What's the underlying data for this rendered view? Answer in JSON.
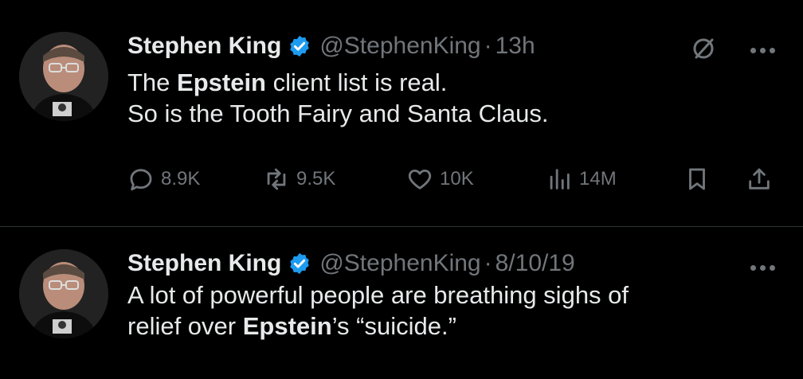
{
  "tweets": [
    {
      "author_name": "Stephen King",
      "handle": "@StephenKing",
      "separator": "·",
      "time": "13h",
      "body_lines": [
        [
          {
            "text": "The ",
            "bold": false
          },
          {
            "text": "Epstein",
            "bold": true
          },
          {
            "text": " client list is real.",
            "bold": false
          }
        ],
        [
          {
            "text": "So is the Tooth Fairy and Santa Claus.",
            "bold": false
          }
        ]
      ],
      "stats": {
        "replies": "8.9K",
        "reposts": "9.5K",
        "likes": "10K",
        "views": "14M"
      }
    },
    {
      "author_name": "Stephen King",
      "handle": "@StephenKing",
      "separator": "·",
      "time": "8/10/19",
      "body_lines": [
        [
          {
            "text": "A lot of powerful people are breathing sighs of",
            "bold": false
          }
        ],
        [
          {
            "text": "relief over ",
            "bold": false
          },
          {
            "text": "Epstein",
            "bold": true
          },
          {
            "text": "’s “suicide.”",
            "bold": false
          }
        ]
      ]
    }
  ],
  "colors": {
    "background": "#000000",
    "text": "#e7e9ea",
    "muted": "#71767b",
    "verified": "#1d9bf0",
    "divider": "#2f3336"
  },
  "icons": [
    "verified-badge-icon",
    "grok-icon",
    "more-icon",
    "reply-icon",
    "repost-icon",
    "like-icon",
    "views-icon",
    "bookmark-icon",
    "share-icon"
  ]
}
